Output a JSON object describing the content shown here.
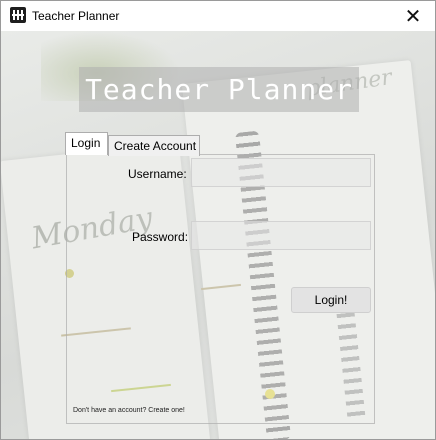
{
  "window": {
    "title": "Teacher Planner",
    "close_glyph": "✕"
  },
  "heading": {
    "text": "Teacher Planner"
  },
  "tabs": [
    {
      "label": "Login",
      "selected": true
    },
    {
      "label": "Create Account",
      "selected": false
    }
  ],
  "login_form": {
    "username_label": "Username:",
    "username_value": "",
    "password_label": "Password:",
    "password_value": "",
    "login_button": "Login!",
    "create_account_prompt": "Don't have an account? Create one!"
  },
  "icons": {
    "app": "planner-app-icon",
    "close": "close-icon"
  },
  "colors": {
    "heading_bg": "#afafaf",
    "heading_text": "#ffffff",
    "button_bg": "#e3e3e3"
  }
}
